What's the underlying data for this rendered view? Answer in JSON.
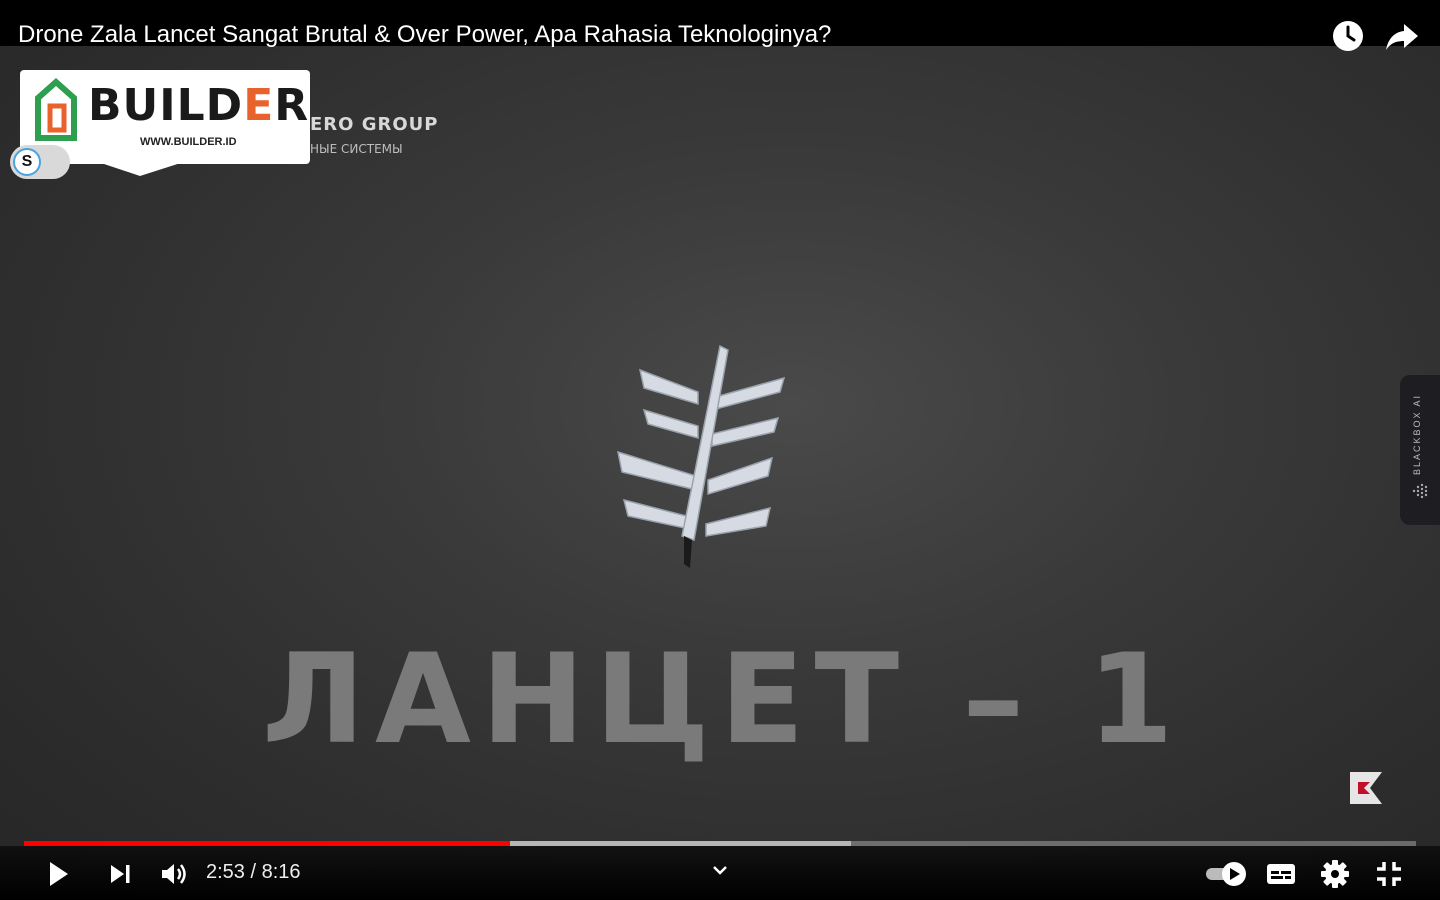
{
  "video": {
    "title": "Drone Zala Lancet Sangat Brutal & Over Power, Apa Rahasia Teknologinya?"
  },
  "top_actions": {
    "watch_later_icon": "clock-icon",
    "share_icon": "share-arrow-icon"
  },
  "overlay": {
    "brand_top": "ERO GROUP",
    "brand_sub": "НЫЕ СИСТЕМЫ",
    "builder_word_main": "BUILD",
    "builder_word_accent": "E",
    "builder_word_tail": "R",
    "builder_url": "WWW.BUILDER.ID",
    "toggle_letter": "S",
    "caption": "ЛАНЦЕТ – 1"
  },
  "side_tab": {
    "label": "BLACKBOX AI"
  },
  "player": {
    "current_time": "2:53",
    "duration": "8:16",
    "time_display": "2:53 / 8:16",
    "played_fraction": 0.349,
    "buffered_fraction": 0.594
  },
  "colors": {
    "progress_played": "#ff0000",
    "builder_accent": "#e8632b",
    "builder_logo_green": "#2e9e4f"
  }
}
